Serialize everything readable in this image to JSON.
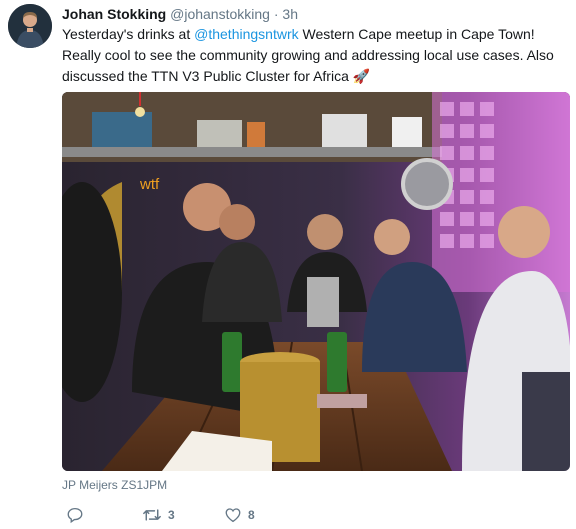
{
  "tweet": {
    "display_name": "Johan Stokking",
    "handle": "@johanstokking",
    "separator": "·",
    "time": "3h",
    "text_before_mention": "Yesterday's drinks at ",
    "mention": "@thethingsntwrk",
    "text_after_mention": " Western Cape meetup in Cape Town! Really cool to see the community growing and addressing local use cases. Also discussed the TTN V3 Public Cluster for Africa 🚀",
    "photo_credit": "JP Meijers ZS1JPM",
    "photo_sign_text": "wtf",
    "actions": {
      "reply_icon": "reply-icon",
      "retweet_icon": "retweet-icon",
      "retweet_count": "3",
      "like_icon": "heart-icon",
      "like_count": "8"
    }
  },
  "colors": {
    "link": "#1b95e0",
    "secondary_text": "#657786",
    "primary_text": "#14171a"
  }
}
